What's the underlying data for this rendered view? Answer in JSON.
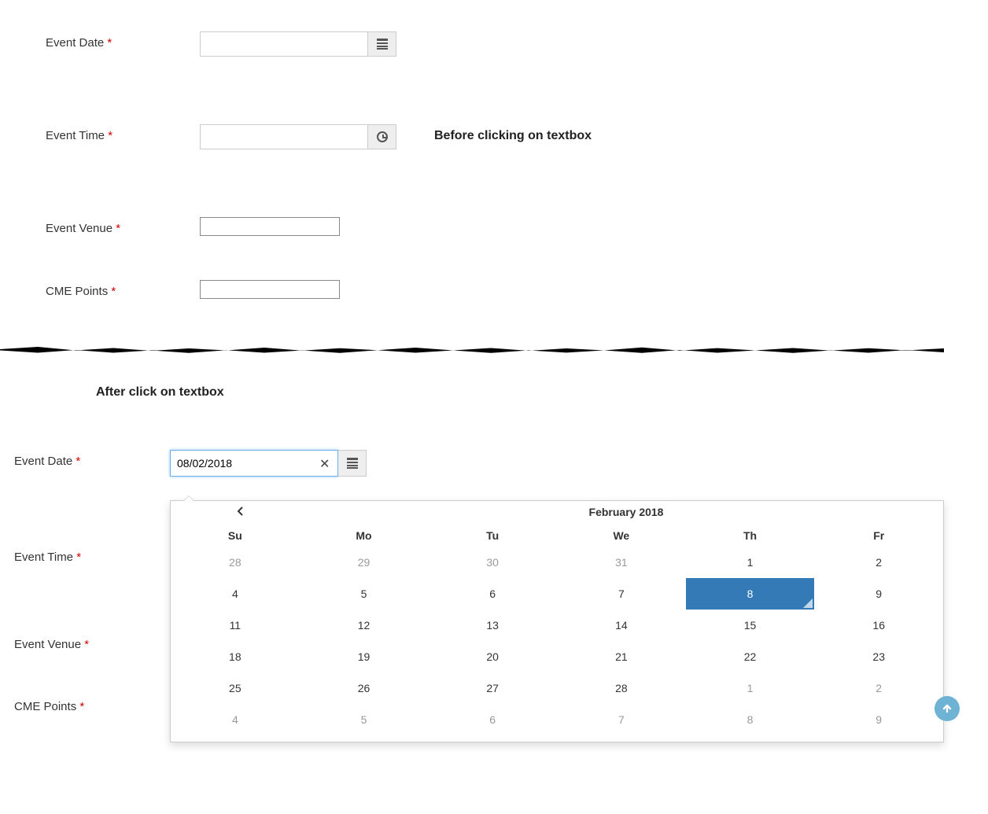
{
  "top": {
    "fields": {
      "event_date": {
        "label": "Event Date",
        "value": ""
      },
      "event_time": {
        "label": "Event Time",
        "value": ""
      },
      "event_venue": {
        "label": "Event Venue",
        "value": ""
      },
      "cme_points": {
        "label": "CME Points",
        "value": ""
      }
    },
    "annotation": "Before clicking on textbox"
  },
  "bottom": {
    "title": "After click on textbox",
    "fields": {
      "event_date": {
        "label": "Event Date",
        "value": "08/02/2018"
      },
      "event_time": {
        "label": "Event Time",
        "value": ""
      },
      "event_venue": {
        "label": "Event Venue",
        "value": ""
      },
      "cme_points": {
        "label": "CME Points",
        "value": ""
      }
    }
  },
  "required_mark": "*",
  "datepicker": {
    "month_title": "February 2018",
    "dow": [
      "Su",
      "Mo",
      "Tu",
      "We",
      "Th",
      "Fr"
    ],
    "weeks": [
      [
        {
          "d": "28",
          "muted": true
        },
        {
          "d": "29",
          "muted": true
        },
        {
          "d": "30",
          "muted": true
        },
        {
          "d": "31",
          "muted": true
        },
        {
          "d": "1"
        },
        {
          "d": "2"
        }
      ],
      [
        {
          "d": "4"
        },
        {
          "d": "5"
        },
        {
          "d": "6"
        },
        {
          "d": "7"
        },
        {
          "d": "8",
          "selected": true
        },
        {
          "d": "9"
        }
      ],
      [
        {
          "d": "11"
        },
        {
          "d": "12"
        },
        {
          "d": "13"
        },
        {
          "d": "14"
        },
        {
          "d": "15"
        },
        {
          "d": "16"
        }
      ],
      [
        {
          "d": "18"
        },
        {
          "d": "19"
        },
        {
          "d": "20"
        },
        {
          "d": "21"
        },
        {
          "d": "22"
        },
        {
          "d": "23"
        }
      ],
      [
        {
          "d": "25"
        },
        {
          "d": "26"
        },
        {
          "d": "27"
        },
        {
          "d": "28"
        },
        {
          "d": "1",
          "muted": true
        },
        {
          "d": "2",
          "muted": true
        }
      ],
      [
        {
          "d": "4",
          "muted": true
        },
        {
          "d": "5",
          "muted": true
        },
        {
          "d": "6",
          "muted": true
        },
        {
          "d": "7",
          "muted": true
        },
        {
          "d": "8",
          "muted": true
        },
        {
          "d": "9",
          "muted": true
        }
      ]
    ]
  }
}
